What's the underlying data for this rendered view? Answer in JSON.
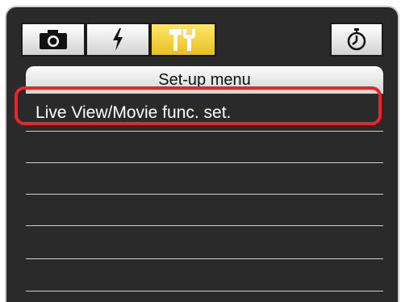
{
  "tabs": [
    {
      "name": "shooting",
      "icon": "camera-icon",
      "active": false
    },
    {
      "name": "flash",
      "icon": "flash-icon",
      "active": false
    },
    {
      "name": "setup",
      "icon": "tools-icon",
      "active": true
    },
    {
      "name": "timer",
      "icon": "stopwatch-icon",
      "active": false
    }
  ],
  "menu": {
    "title": "Set-up menu",
    "items": [
      {
        "label": "Live View/Movie func. set.",
        "selected": true
      },
      {
        "label": ""
      },
      {
        "label": ""
      },
      {
        "label": ""
      },
      {
        "label": ""
      },
      {
        "label": ""
      }
    ]
  },
  "colors": {
    "active_tab": "#f3d23c",
    "highlight": "#e8262a",
    "background": "#2a2a2a"
  }
}
